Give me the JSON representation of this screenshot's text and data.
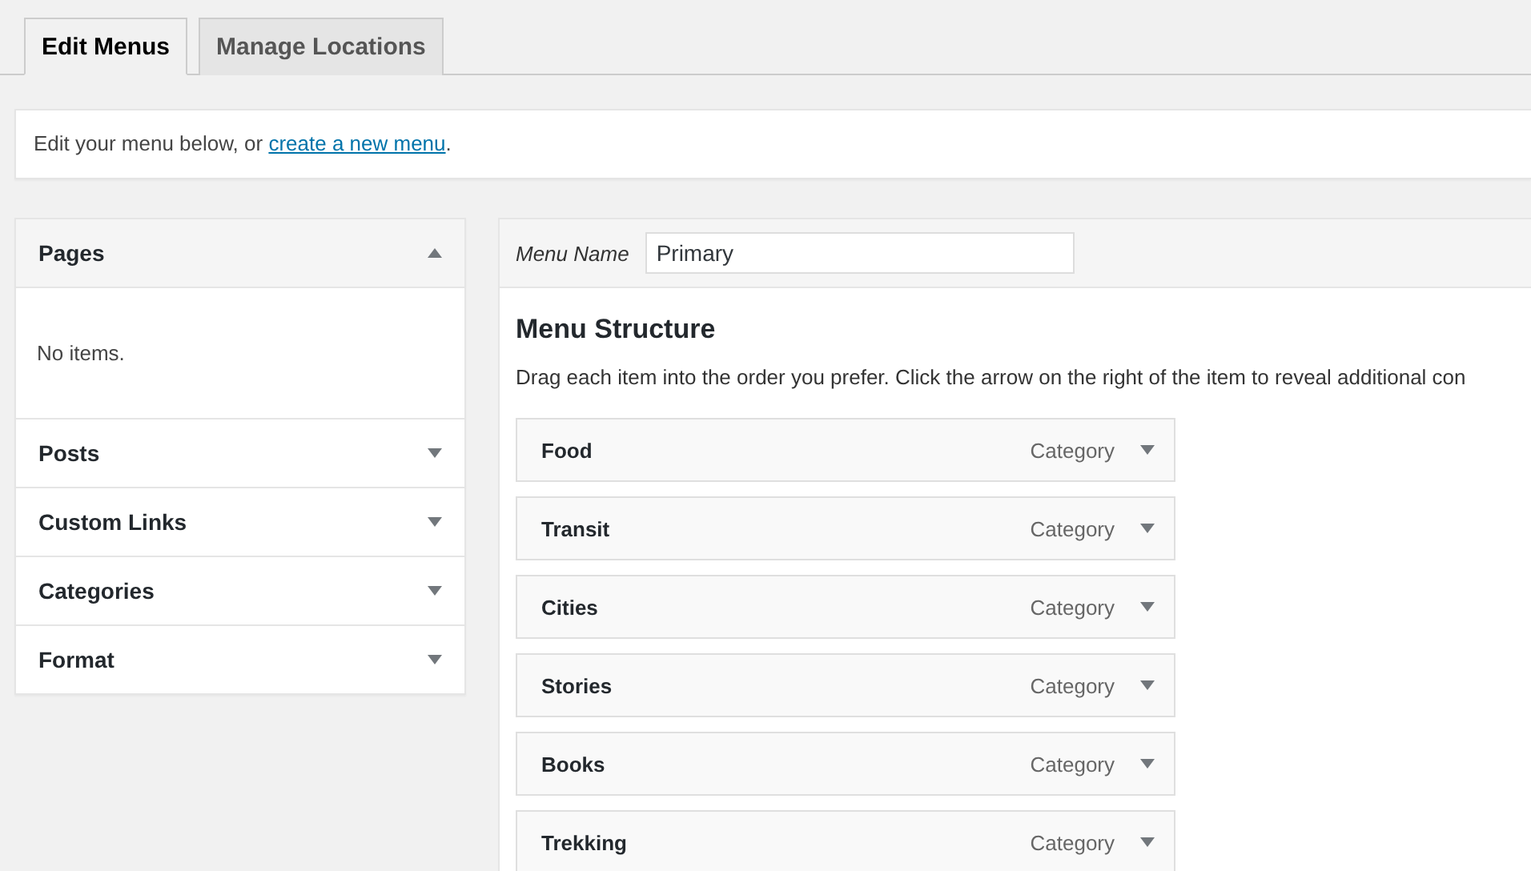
{
  "tabs": [
    {
      "label": "Edit Menus",
      "selected": true
    },
    {
      "label": "Manage Locations",
      "selected": false
    }
  ],
  "notice": {
    "text": "Edit your menu below, or ",
    "link": "create a new menu",
    "after": "."
  },
  "sidebar": {
    "sections": [
      {
        "title": "Pages",
        "expanded": true,
        "body": "No items."
      },
      {
        "title": "Posts",
        "expanded": false
      },
      {
        "title": "Custom Links",
        "expanded": false
      },
      {
        "title": "Categories",
        "expanded": false
      },
      {
        "title": "Format",
        "expanded": false
      }
    ]
  },
  "menu_name": {
    "label": "Menu Name",
    "value": "Primary"
  },
  "structure": {
    "title": "Menu Structure",
    "description": "Drag each item into the order you prefer. Click the arrow on the right of the item to reveal additional con",
    "items": [
      {
        "title": "Food",
        "type": "Category"
      },
      {
        "title": "Transit",
        "type": "Category"
      },
      {
        "title": "Cities",
        "type": "Category"
      },
      {
        "title": "Stories",
        "type": "Category"
      },
      {
        "title": "Books",
        "type": "Category"
      },
      {
        "title": "Trekking",
        "type": "Category"
      }
    ]
  }
}
